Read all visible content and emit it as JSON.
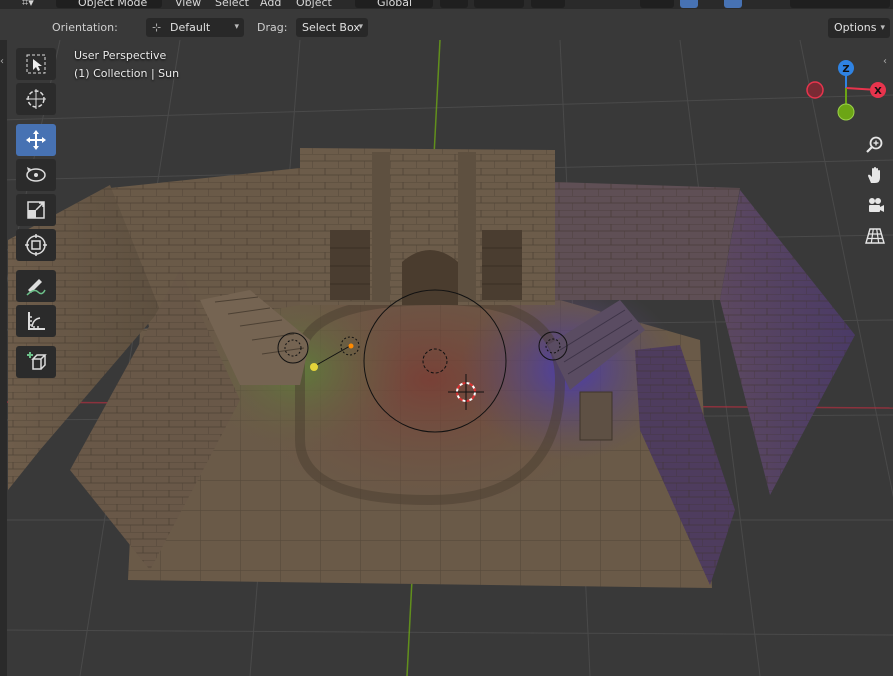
{
  "header": {
    "mode_label": "Object Mode",
    "menu_view": "View",
    "menu_select": "Select",
    "menu_add": "Add",
    "menu_object": "Object",
    "transform_orientation": "Global"
  },
  "tool_settings": {
    "orientation_label": "Orientation:",
    "orientation_value": "Default",
    "drag_label": "Drag:",
    "drag_value": "Select Box",
    "options_label": "Options"
  },
  "viewport": {
    "view_name": "User Perspective",
    "collection_info": "(1) Collection | Sun"
  },
  "gizmo": {
    "z_label": "Z",
    "x_label": "X",
    "colors": {
      "x": "#e8344d",
      "y": "#6ca515",
      "z": "#2f83e3"
    }
  },
  "toolbar": {
    "tools": [
      "select-box",
      "cursor",
      "move",
      "rotate",
      "scale",
      "transform",
      "annotate",
      "measure",
      "add-cube"
    ],
    "active_tool": "move"
  },
  "nav": [
    "zoom",
    "pan",
    "camera-view",
    "perspective-toggle"
  ]
}
